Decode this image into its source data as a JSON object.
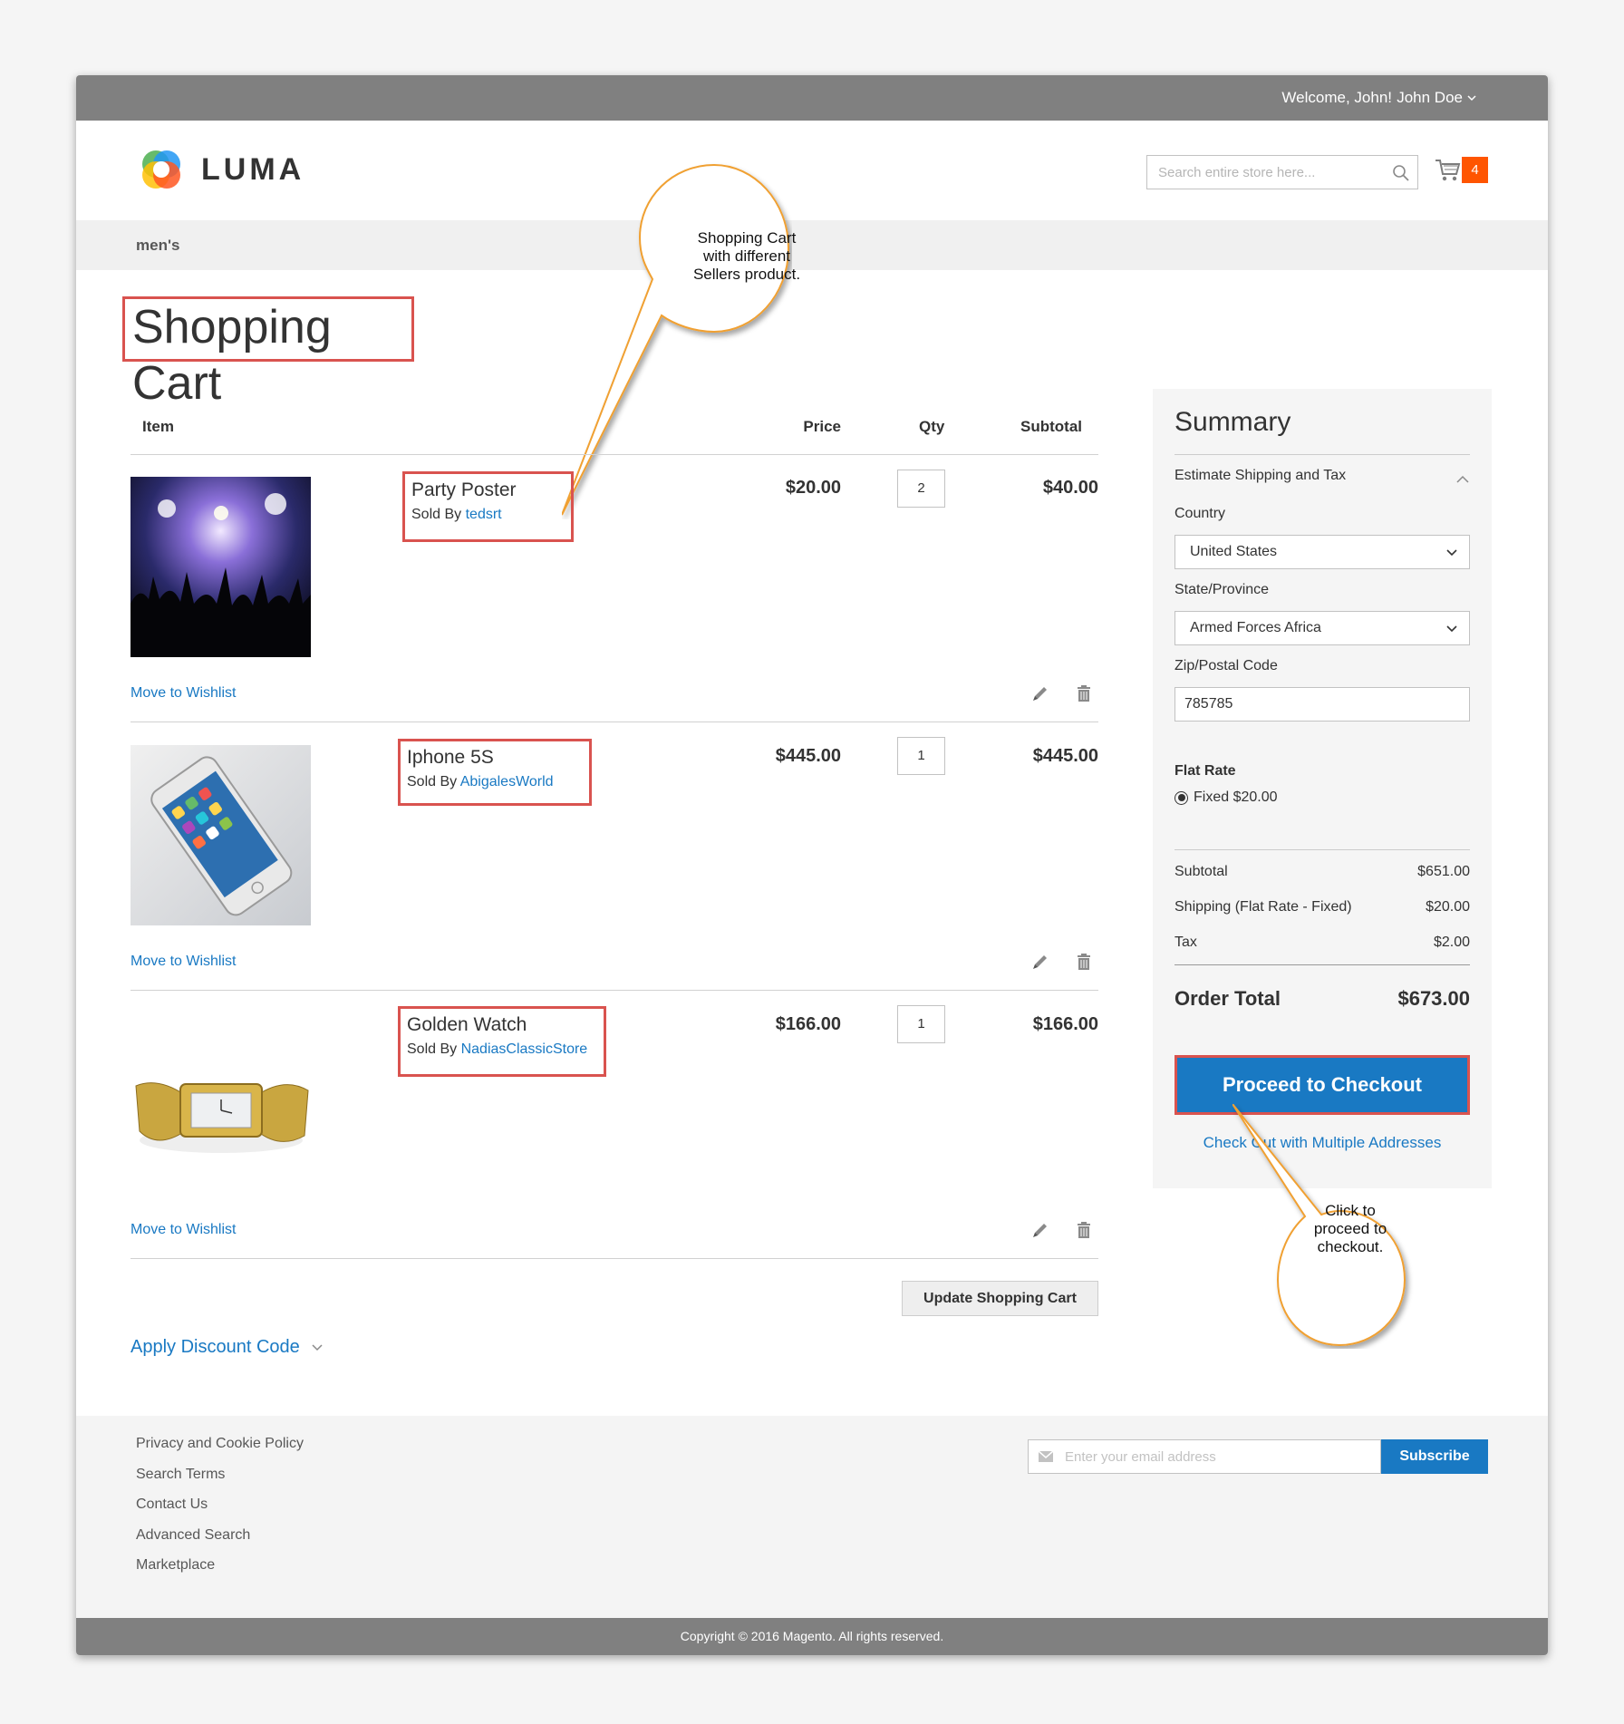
{
  "header": {
    "welcome": "Welcome, John!",
    "user_name": "John Doe",
    "logo_text": "LUMA",
    "search_placeholder": "Search entire store here...",
    "cart_count": "4"
  },
  "nav": {
    "item": "men's"
  },
  "page_title": "Shopping Cart",
  "callouts": {
    "sellers_note": "Shopping Cart with different Sellers product.",
    "checkout_note": "Click to proceed to checkout."
  },
  "table": {
    "headers": {
      "item": "Item",
      "price": "Price",
      "qty": "Qty",
      "subtotal": "Subtotal"
    },
    "sold_by_label": "Sold By",
    "wishlist_label": "Move to Wishlist",
    "rows": [
      {
        "name": "Party Poster",
        "seller": "tedsrt",
        "price": "$20.00",
        "qty": "2",
        "subtotal": "$40.00"
      },
      {
        "name": "Iphone 5S",
        "seller": "AbigalesWorld",
        "price": "$445.00",
        "qty": "1",
        "subtotal": "$445.00"
      },
      {
        "name": "Golden Watch",
        "seller": "NadiasClassicStore",
        "price": "$166.00",
        "qty": "1",
        "subtotal": "$166.00"
      }
    ],
    "update_button": "Update Shopping Cart",
    "discount_label": "Apply Discount Code"
  },
  "summary": {
    "title": "Summary",
    "estimate_label": "Estimate Shipping and Tax",
    "country_label": "Country",
    "country_value": "United States",
    "state_label": "State/Province",
    "state_value": "Armed Forces Africa",
    "zip_label": "Zip/Postal Code",
    "zip_value": "785785",
    "flat_rate_label": "Flat Rate",
    "fixed_option": "Fixed $20.00",
    "subtotal_label": "Subtotal",
    "subtotal_value": "$651.00",
    "shipping_label": "Shipping (Flat Rate - Fixed)",
    "shipping_value": "$20.00",
    "tax_label": "Tax",
    "tax_value": "$2.00",
    "order_total_label": "Order Total",
    "order_total_value": "$673.00",
    "checkout_button": "Proceed to Checkout",
    "multi_address_link": "Check Out with Multiple Addresses"
  },
  "footer": {
    "links": [
      "Privacy and Cookie Policy",
      "Search Terms",
      "Contact Us",
      "Advanced Search",
      "Marketplace"
    ],
    "email_placeholder": "Enter your email address",
    "subscribe_button": "Subscribe",
    "copyright": "Copyright © 2016 Magento. All rights reserved."
  },
  "colors": {
    "accent_blue": "#1979c3",
    "cart_badge": "#ff5501",
    "highlight_red": "#d9534f",
    "callout_orange": "#f0a030",
    "topbar_gray": "#808080"
  }
}
